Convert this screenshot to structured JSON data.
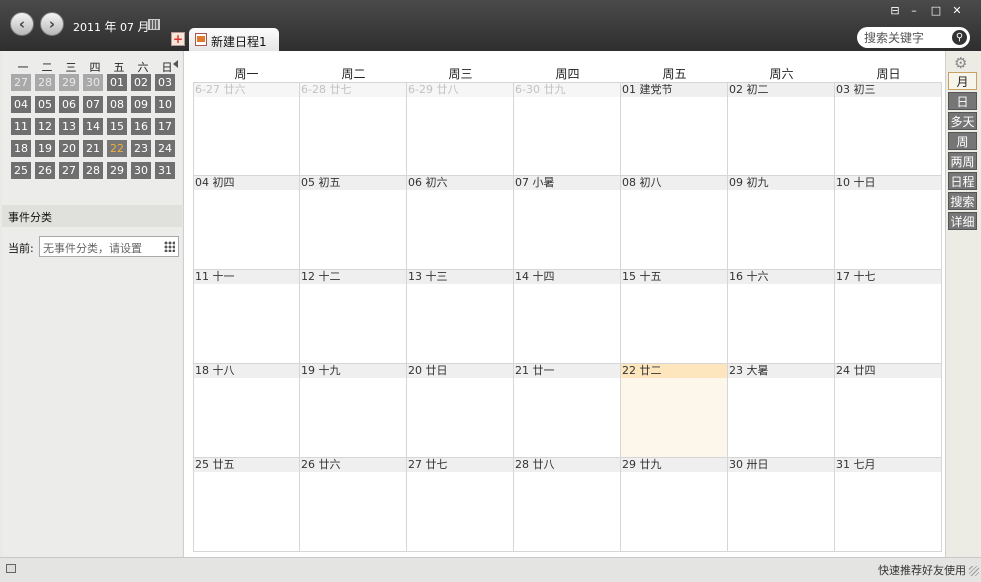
{
  "header": {
    "year": "2011",
    "year_unit": "年",
    "month": "07",
    "month_unit": "月",
    "prev_icon": "chevron-left-icon",
    "next_icon": "chevron-right-icon",
    "win_controls": [
      "⊟",
      "–",
      "□",
      "✕"
    ]
  },
  "tab": {
    "label": "新建日程1",
    "add_icon": "+"
  },
  "search": {
    "placeholder": "搜索关键字"
  },
  "mini_calendar": {
    "weekdays": [
      "一",
      "二",
      "三",
      "四",
      "五",
      "六",
      "日"
    ],
    "weeks": [
      [
        "27",
        "28",
        "29",
        "30",
        "01",
        "02",
        "03"
      ],
      [
        "04",
        "05",
        "06",
        "07",
        "08",
        "09",
        "10"
      ],
      [
        "11",
        "12",
        "13",
        "14",
        "15",
        "16",
        "17"
      ],
      [
        "18",
        "19",
        "20",
        "21",
        "22",
        "23",
        "24"
      ],
      [
        "25",
        "26",
        "27",
        "28",
        "29",
        "30",
        "31"
      ]
    ],
    "other_month_count": 4,
    "today": "22"
  },
  "category": {
    "title": "事件分类",
    "current_label": "当前:",
    "current_value": "无事件分类，请设置"
  },
  "month_view": {
    "weekdays": [
      "周一",
      "周二",
      "周三",
      "周四",
      "周五",
      "周六",
      "周日"
    ],
    "weeks": [
      [
        "6-27 廿六",
        "6-28 廿七",
        "6-29 廿八",
        "6-30 廿九",
        "01 建党节",
        "02 初二",
        "03 初三"
      ],
      [
        "04 初四",
        "05 初五",
        "06 初六",
        "07 小暑",
        "08 初八",
        "09 初九",
        "10 十日"
      ],
      [
        "11 十一",
        "12 十二",
        "13 十三",
        "14 十四",
        "15 十五",
        "16 十六",
        "17 十七"
      ],
      [
        "18 十八",
        "19 十九",
        "20 廿日",
        "21 廿一",
        "22 廿二",
        "23 大暑",
        "24 廿四"
      ],
      [
        "25 廿五",
        "26 廿六",
        "27 廿七",
        "28 廿八",
        "29 廿九",
        "30 卅日",
        "31 七月"
      ]
    ],
    "other_month_count": 4,
    "today": "22 廿二"
  },
  "views": [
    {
      "label": "月",
      "active": true
    },
    {
      "label": "日",
      "active": false
    },
    {
      "label": "多天",
      "active": false
    },
    {
      "label": "周",
      "active": false
    },
    {
      "label": "两周",
      "active": false
    },
    {
      "label": "日程",
      "active": false
    },
    {
      "label": "搜索",
      "active": false
    },
    {
      "label": "详细",
      "active": false
    }
  ],
  "status": {
    "text": "快速推荐好友使用"
  },
  "colors": {
    "today_text": "#f0b040",
    "today_cell": "#fdf6ea",
    "active_view": "#f7f4ec"
  }
}
